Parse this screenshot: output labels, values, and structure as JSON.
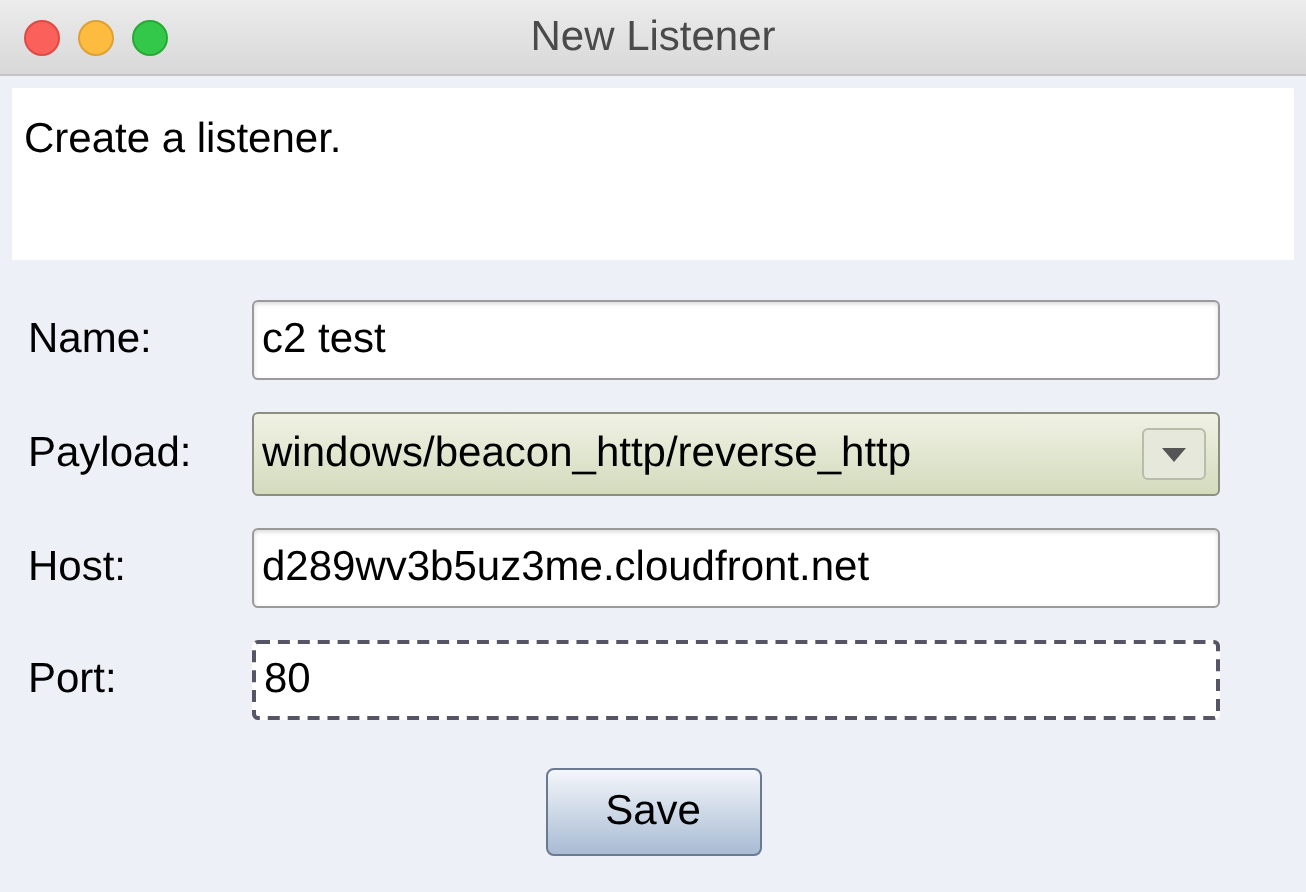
{
  "window": {
    "title": "New Listener"
  },
  "description": "Create a listener.",
  "fields": [
    {
      "kind": "text",
      "label": "Name:",
      "value": "c2 test",
      "focused": false
    },
    {
      "kind": "select",
      "label": "Payload:",
      "value": "windows/beacon_http/reverse_http",
      "focused": false
    },
    {
      "kind": "text",
      "label": "Host:",
      "value": "d289wv3b5uz3me.cloudfront.net",
      "focused": false
    },
    {
      "kind": "text",
      "label": "Port:",
      "value": "80",
      "focused": true
    }
  ],
  "buttons": [
    "Save"
  ]
}
